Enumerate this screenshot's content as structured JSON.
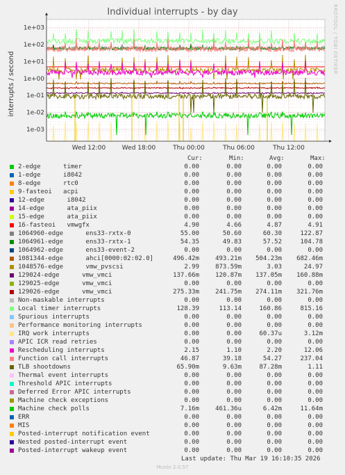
{
  "title": "Individual interrupts - by day",
  "watermark": "RRDTOOL / TOBI OETIKER",
  "footer": "Last update: Thu Mar 19 16:10:35 2026",
  "munin": "Munin 2.0.57",
  "legend_headers": {
    "cur": "Cur:",
    "min": "Min:",
    "avg": "Avg:",
    "max": "Max:"
  },
  "chart_data": {
    "type": "line",
    "title": "Individual interrupts - by day",
    "ylabel": "interrupts / second",
    "yscale": "log",
    "ylim": [
      0.0002,
      3000
    ],
    "yticks": [
      "1e-03",
      "1e-02",
      "1e-01",
      "1e+00",
      "1e+01",
      "1e+02",
      "1e+03"
    ],
    "xticks": [
      "Wed 12:00",
      "Wed 18:00",
      "Thu 00:00",
      "Thu 06:00",
      "Thu 12:00"
    ],
    "grid": true,
    "series": [
      {
        "name": "2-edge      timer",
        "color": "#00cc00",
        "cur": "0.00",
        "min": "0.00",
        "avg": "0.00",
        "max": "0.00"
      },
      {
        "name": "1-edge      i8042",
        "color": "#0066b3",
        "cur": "0.00",
        "min": "0.00",
        "avg": "0.00",
        "max": "0.00"
      },
      {
        "name": "8-edge      rtc0",
        "color": "#ff8000",
        "cur": "0.00",
        "min": "0.00",
        "avg": "0.00",
        "max": "0.00"
      },
      {
        "name": "9-fasteoi   acpi",
        "color": "#ffcc00",
        "cur": "0.00",
        "min": "0.00",
        "avg": "0.00",
        "max": "0.00"
      },
      {
        "name": "12-edge      i8042",
        "color": "#330099",
        "cur": "0.00",
        "min": "0.00",
        "avg": "0.00",
        "max": "0.00"
      },
      {
        "name": "14-edge      ata_piix",
        "color": "#990099",
        "cur": "0.00",
        "min": "0.00",
        "avg": "0.00",
        "max": "0.00"
      },
      {
        "name": "15-edge      ata_piix",
        "color": "#ccff00",
        "cur": "0.00",
        "min": "0.00",
        "avg": "0.00",
        "max": "0.00"
      },
      {
        "name": "16-fasteoi   vmwgfx",
        "color": "#ff0000",
        "cur": "4.90",
        "min": "4.66",
        "avg": "4.87",
        "max": "4.91"
      },
      {
        "name": "1064960-edge      ens33-rxtx-0",
        "color": "#808080",
        "cur": "55.00",
        "min": "50.60",
        "avg": "60.30",
        "max": "122.87"
      },
      {
        "name": "1064961-edge      ens33-rxtx-1",
        "color": "#008f00",
        "cur": "54.35",
        "min": "49.83",
        "avg": "57.52",
        "max": "104.78"
      },
      {
        "name": "1064962-edge      ens33-event-2",
        "color": "#00487d",
        "cur": "0.00",
        "min": "0.00",
        "avg": "0.00",
        "max": "0.00"
      },
      {
        "name": "1081344-edge      ahci[0000:02:02.0]",
        "color": "#b35a00",
        "cur": "496.42m",
        "min": "493.21m",
        "avg": "504.23m",
        "max": "682.46m"
      },
      {
        "name": "1048576-edge      vmw_pvscsi",
        "color": "#b38f00",
        "cur": "2.99",
        "min": "873.59m",
        "avg": "3.03",
        "max": "24.97"
      },
      {
        "name": "129024-edge      vmw_vmci",
        "color": "#6b006b",
        "cur": "137.66m",
        "min": "120.87m",
        "avg": "137.05m",
        "max": "160.88m"
      },
      {
        "name": "129025-edge      vmw_vmci",
        "color": "#8fb300",
        "cur": "0.00",
        "min": "0.00",
        "avg": "0.00",
        "max": "0.00"
      },
      {
        "name": "129026-edge      vmw_vmci",
        "color": "#b30000",
        "cur": "275.33m",
        "min": "241.75m",
        "avg": "274.11m",
        "max": "321.76m"
      },
      {
        "name": "Non-maskable interrupts",
        "color": "#bebebe",
        "cur": "0.00",
        "min": "0.00",
        "avg": "0.00",
        "max": "0.00"
      },
      {
        "name": "Local timer interrupts",
        "color": "#80ff80",
        "cur": "128.39",
        "min": "113.14",
        "avg": "160.86",
        "max": "815.16"
      },
      {
        "name": "Spurious interrupts",
        "color": "#80c9ff",
        "cur": "0.00",
        "min": "0.00",
        "avg": "0.00",
        "max": "0.00"
      },
      {
        "name": "Performance monitoring interrupts",
        "color": "#ffc080",
        "cur": "0.00",
        "min": "0.00",
        "avg": "0.00",
        "max": "0.00"
      },
      {
        "name": "IRQ work interrupts",
        "color": "#ffe680",
        "cur": "0.00",
        "min": "0.00",
        "avg": "60.37u",
        "max": "3.12m"
      },
      {
        "name": "APIC ICR read retries",
        "color": "#aa80ff",
        "cur": "0.00",
        "min": "0.00",
        "avg": "0.00",
        "max": "0.00"
      },
      {
        "name": "Rescheduling interrupts",
        "color": "#ee00cc",
        "cur": "2.15",
        "min": "1.10",
        "avg": "2.20",
        "max": "12.06"
      },
      {
        "name": "Function call interrupts",
        "color": "#ff8080",
        "cur": "46.87",
        "min": "39.18",
        "avg": "54.27",
        "max": "237.04"
      },
      {
        "name": "TLB shootdowns",
        "color": "#666600",
        "cur": "65.90m",
        "min": "9.63m",
        "avg": "87.28m",
        "max": "1.11"
      },
      {
        "name": "Thermal event interrupts",
        "color": "#ffbfff",
        "cur": "0.00",
        "min": "0.00",
        "avg": "0.00",
        "max": "0.00"
      },
      {
        "name": "Threshold APIC interrupts",
        "color": "#00ffcc",
        "cur": "0.00",
        "min": "0.00",
        "avg": "0.00",
        "max": "0.00"
      },
      {
        "name": "Deferred Error APIC interrupts",
        "color": "#cc6699",
        "cur": "0.00",
        "min": "0.00",
        "avg": "0.00",
        "max": "0.00"
      },
      {
        "name": "Machine check exceptions",
        "color": "#999900",
        "cur": "0.00",
        "min": "0.00",
        "avg": "0.00",
        "max": "0.00"
      },
      {
        "name": "Machine check polls",
        "color": "#00cc00",
        "cur": "7.16m",
        "min": "461.36u",
        "avg": "6.42m",
        "max": "11.64m"
      },
      {
        "name": "ERR",
        "color": "#0066b3",
        "cur": "0.00",
        "min": "0.00",
        "avg": "0.00",
        "max": "0.00"
      },
      {
        "name": "MIS",
        "color": "#ff8000",
        "cur": "0.00",
        "min": "0.00",
        "avg": "0.00",
        "max": "0.00"
      },
      {
        "name": "Posted-interrupt notification event",
        "color": "#ffcc00",
        "cur": "0.00",
        "min": "0.00",
        "avg": "0.00",
        "max": "0.00"
      },
      {
        "name": "Nested posted-interrupt event",
        "color": "#330099",
        "cur": "0.00",
        "min": "0.00",
        "avg": "0.00",
        "max": "0.00"
      },
      {
        "name": "Posted-interrupt wakeup event",
        "color": "#990099",
        "cur": "0.00",
        "min": "0.00",
        "avg": "0.00",
        "max": "0.00"
      }
    ]
  }
}
